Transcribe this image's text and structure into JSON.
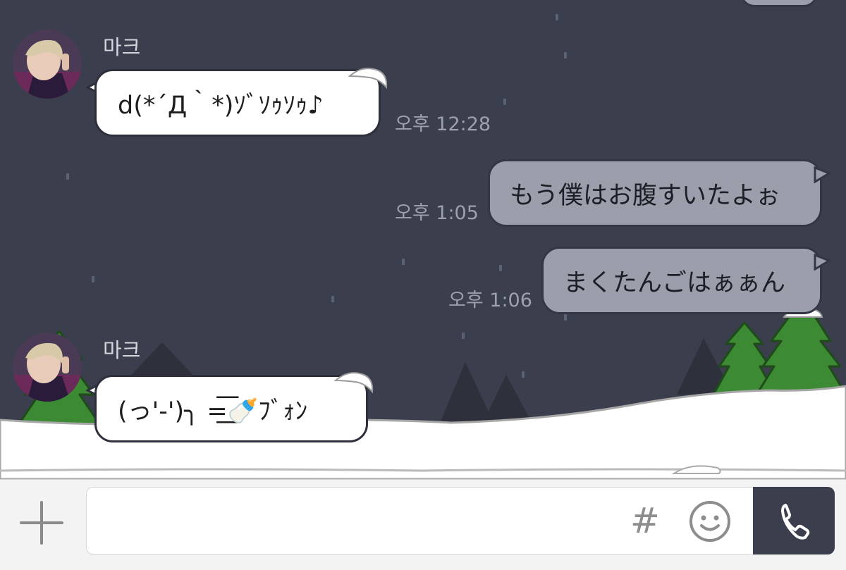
{
  "messages": [
    {
      "sender": "마크",
      "direction": "in",
      "text": "d(*´Д｀*)ｿﾞｿｩｿｩ♪",
      "time": "오후 12:28"
    },
    {
      "direction": "out",
      "text": "もう僕はお腹すいたよぉ",
      "time": "오후 1:05"
    },
    {
      "direction": "out",
      "text": "まくたんごはぁぁん",
      "time": "오후 1:06"
    },
    {
      "sender": "마크",
      "direction": "in",
      "text": "(っ'-')╮ =͟͟͞͞🍼ﾌﾞｫﾝ"
    }
  ],
  "composer": {
    "input_value": "",
    "hash_symbol": "#"
  },
  "icons": {
    "add": "plus-icon",
    "emoji": "smiley-icon",
    "call": "phone-icon",
    "avatar": "user-avatar"
  },
  "colors": {
    "background": "#3a3e4d",
    "incoming_bubble": "#ffffff",
    "outgoing_bubble": "#9b9fac",
    "tree_green": "#3c8a33",
    "snow": "#ffffff"
  }
}
